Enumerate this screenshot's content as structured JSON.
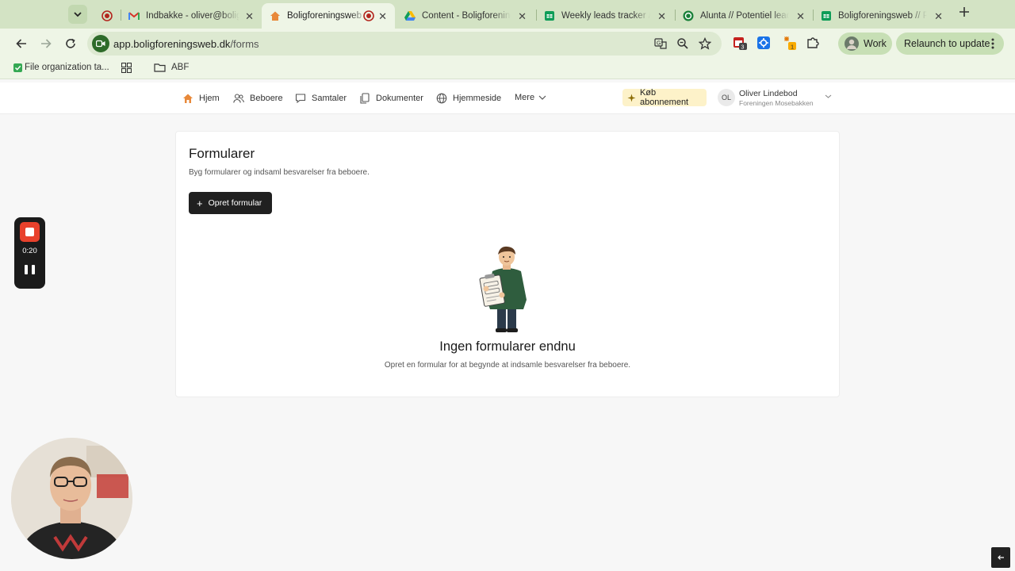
{
  "browser": {
    "tabs": [
      {
        "title": "",
        "icon": "record-icon"
      },
      {
        "title": "Indbakke - oliver@boligforeningsweb.dk",
        "icon": "gmail-icon"
      },
      {
        "title": "Boligforeningsweb",
        "icon": "house-icon",
        "active": true
      },
      {
        "title": "Content - Boligforeningsweb",
        "icon": "google-drive-icon"
      },
      {
        "title": "Weekly leads tracker // Boligforeningsweb",
        "icon": "sheets-icon"
      },
      {
        "title": "Alunta // Potentiel lead",
        "icon": "alunta-icon"
      },
      {
        "title": "Boligforeningsweb // Potentielle leads",
        "icon": "sheets-icon"
      }
    ],
    "url_host": "app.boligforeningsweb.dk",
    "url_path": "/forms",
    "extension_badge_1": "3",
    "extension_badge_2": "1",
    "profile_label": "Work",
    "relaunch_label": "Relaunch to update",
    "bookmarks": [
      {
        "label": "File organization ta...",
        "icon": "check-icon"
      },
      {
        "label": "",
        "icon": "apps-grid-icon"
      },
      {
        "label": "ABF",
        "icon": "folder-icon"
      }
    ]
  },
  "app": {
    "nav": [
      {
        "label": "Hjem",
        "icon": "home-icon"
      },
      {
        "label": "Beboere",
        "icon": "users-icon"
      },
      {
        "label": "Samtaler",
        "icon": "chat-icon"
      },
      {
        "label": "Dokumenter",
        "icon": "documents-icon"
      },
      {
        "label": "Hjemmeside",
        "icon": "globe-icon"
      },
      {
        "label": "Mere",
        "icon": "chevron-down-icon"
      }
    ],
    "buy_label": "Køb abonnement",
    "user": {
      "initials": "OL",
      "name": "Oliver Lindebod",
      "org": "Foreningen Mosebakken"
    },
    "brand_color": "#e8893a"
  },
  "page": {
    "title": "Formularer",
    "subtitle": "Byg formularer og indsaml besvarelser fra beboere.",
    "create_label": "Opret formular",
    "empty_title": "Ingen formularer endnu",
    "empty_subtitle": "Opret en formular for at begynde at indsamle besvarelser fra beboere."
  },
  "recorder": {
    "time": "0:20",
    "accent": "#e8412c"
  }
}
